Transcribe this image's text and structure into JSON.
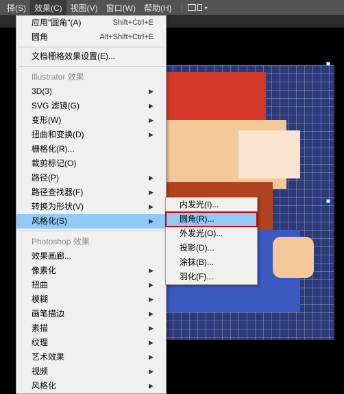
{
  "menubar": {
    "items": [
      {
        "label": "择(S)"
      },
      {
        "label": "效果(C)"
      },
      {
        "label": "视图(V)"
      },
      {
        "label": "窗口(W)"
      },
      {
        "label": "帮助(H)"
      }
    ]
  },
  "effects_menu": {
    "apply_last": {
      "label": "应用\"圆角\"(A)",
      "shortcut": "Shift+Ctrl+E"
    },
    "round": {
      "label": "圆角",
      "shortcut": "Alt+Shift+Ctrl+E"
    },
    "doc_raster": {
      "label": "文档栅格效果设置(E)..."
    },
    "section_illustrator": "Illustrator  效果",
    "items_illustrator": [
      {
        "label": "3D(3)",
        "arrow": true
      },
      {
        "label": "SVG 滤镜(G)",
        "arrow": true
      },
      {
        "label": "变形(W)",
        "arrow": true
      },
      {
        "label": "扭曲和变换(D)",
        "arrow": true
      },
      {
        "label": "栅格化(R)..."
      },
      {
        "label": "裁剪标记(O)"
      },
      {
        "label": "路径(P)",
        "arrow": true
      },
      {
        "label": "路径查找器(F)",
        "arrow": true
      },
      {
        "label": "转换为形状(V)",
        "arrow": true
      },
      {
        "label": "风格化(S)",
        "arrow": true,
        "highlighted": true
      }
    ],
    "section_photoshop": "Photoshop  效果",
    "items_photoshop": [
      {
        "label": "效果画廊..."
      },
      {
        "label": "像素化",
        "arrow": true
      },
      {
        "label": "扭曲",
        "arrow": true
      },
      {
        "label": "模糊",
        "arrow": true
      },
      {
        "label": "画笔描边",
        "arrow": true
      },
      {
        "label": "素描",
        "arrow": true
      },
      {
        "label": "纹理",
        "arrow": true
      },
      {
        "label": "艺术效果",
        "arrow": true
      },
      {
        "label": "视频",
        "arrow": true
      },
      {
        "label": "风格化",
        "arrow": true
      }
    ]
  },
  "stylize_submenu": {
    "items": [
      {
        "label": "内发光(I)..."
      },
      {
        "label": "圆角(R)...",
        "highlighted": true,
        "framed": true
      },
      {
        "label": "外发光(O)..."
      },
      {
        "label": "投影(D)..."
      },
      {
        "label": "涂抹(B)..."
      },
      {
        "label": "羽化(F)..."
      }
    ]
  }
}
